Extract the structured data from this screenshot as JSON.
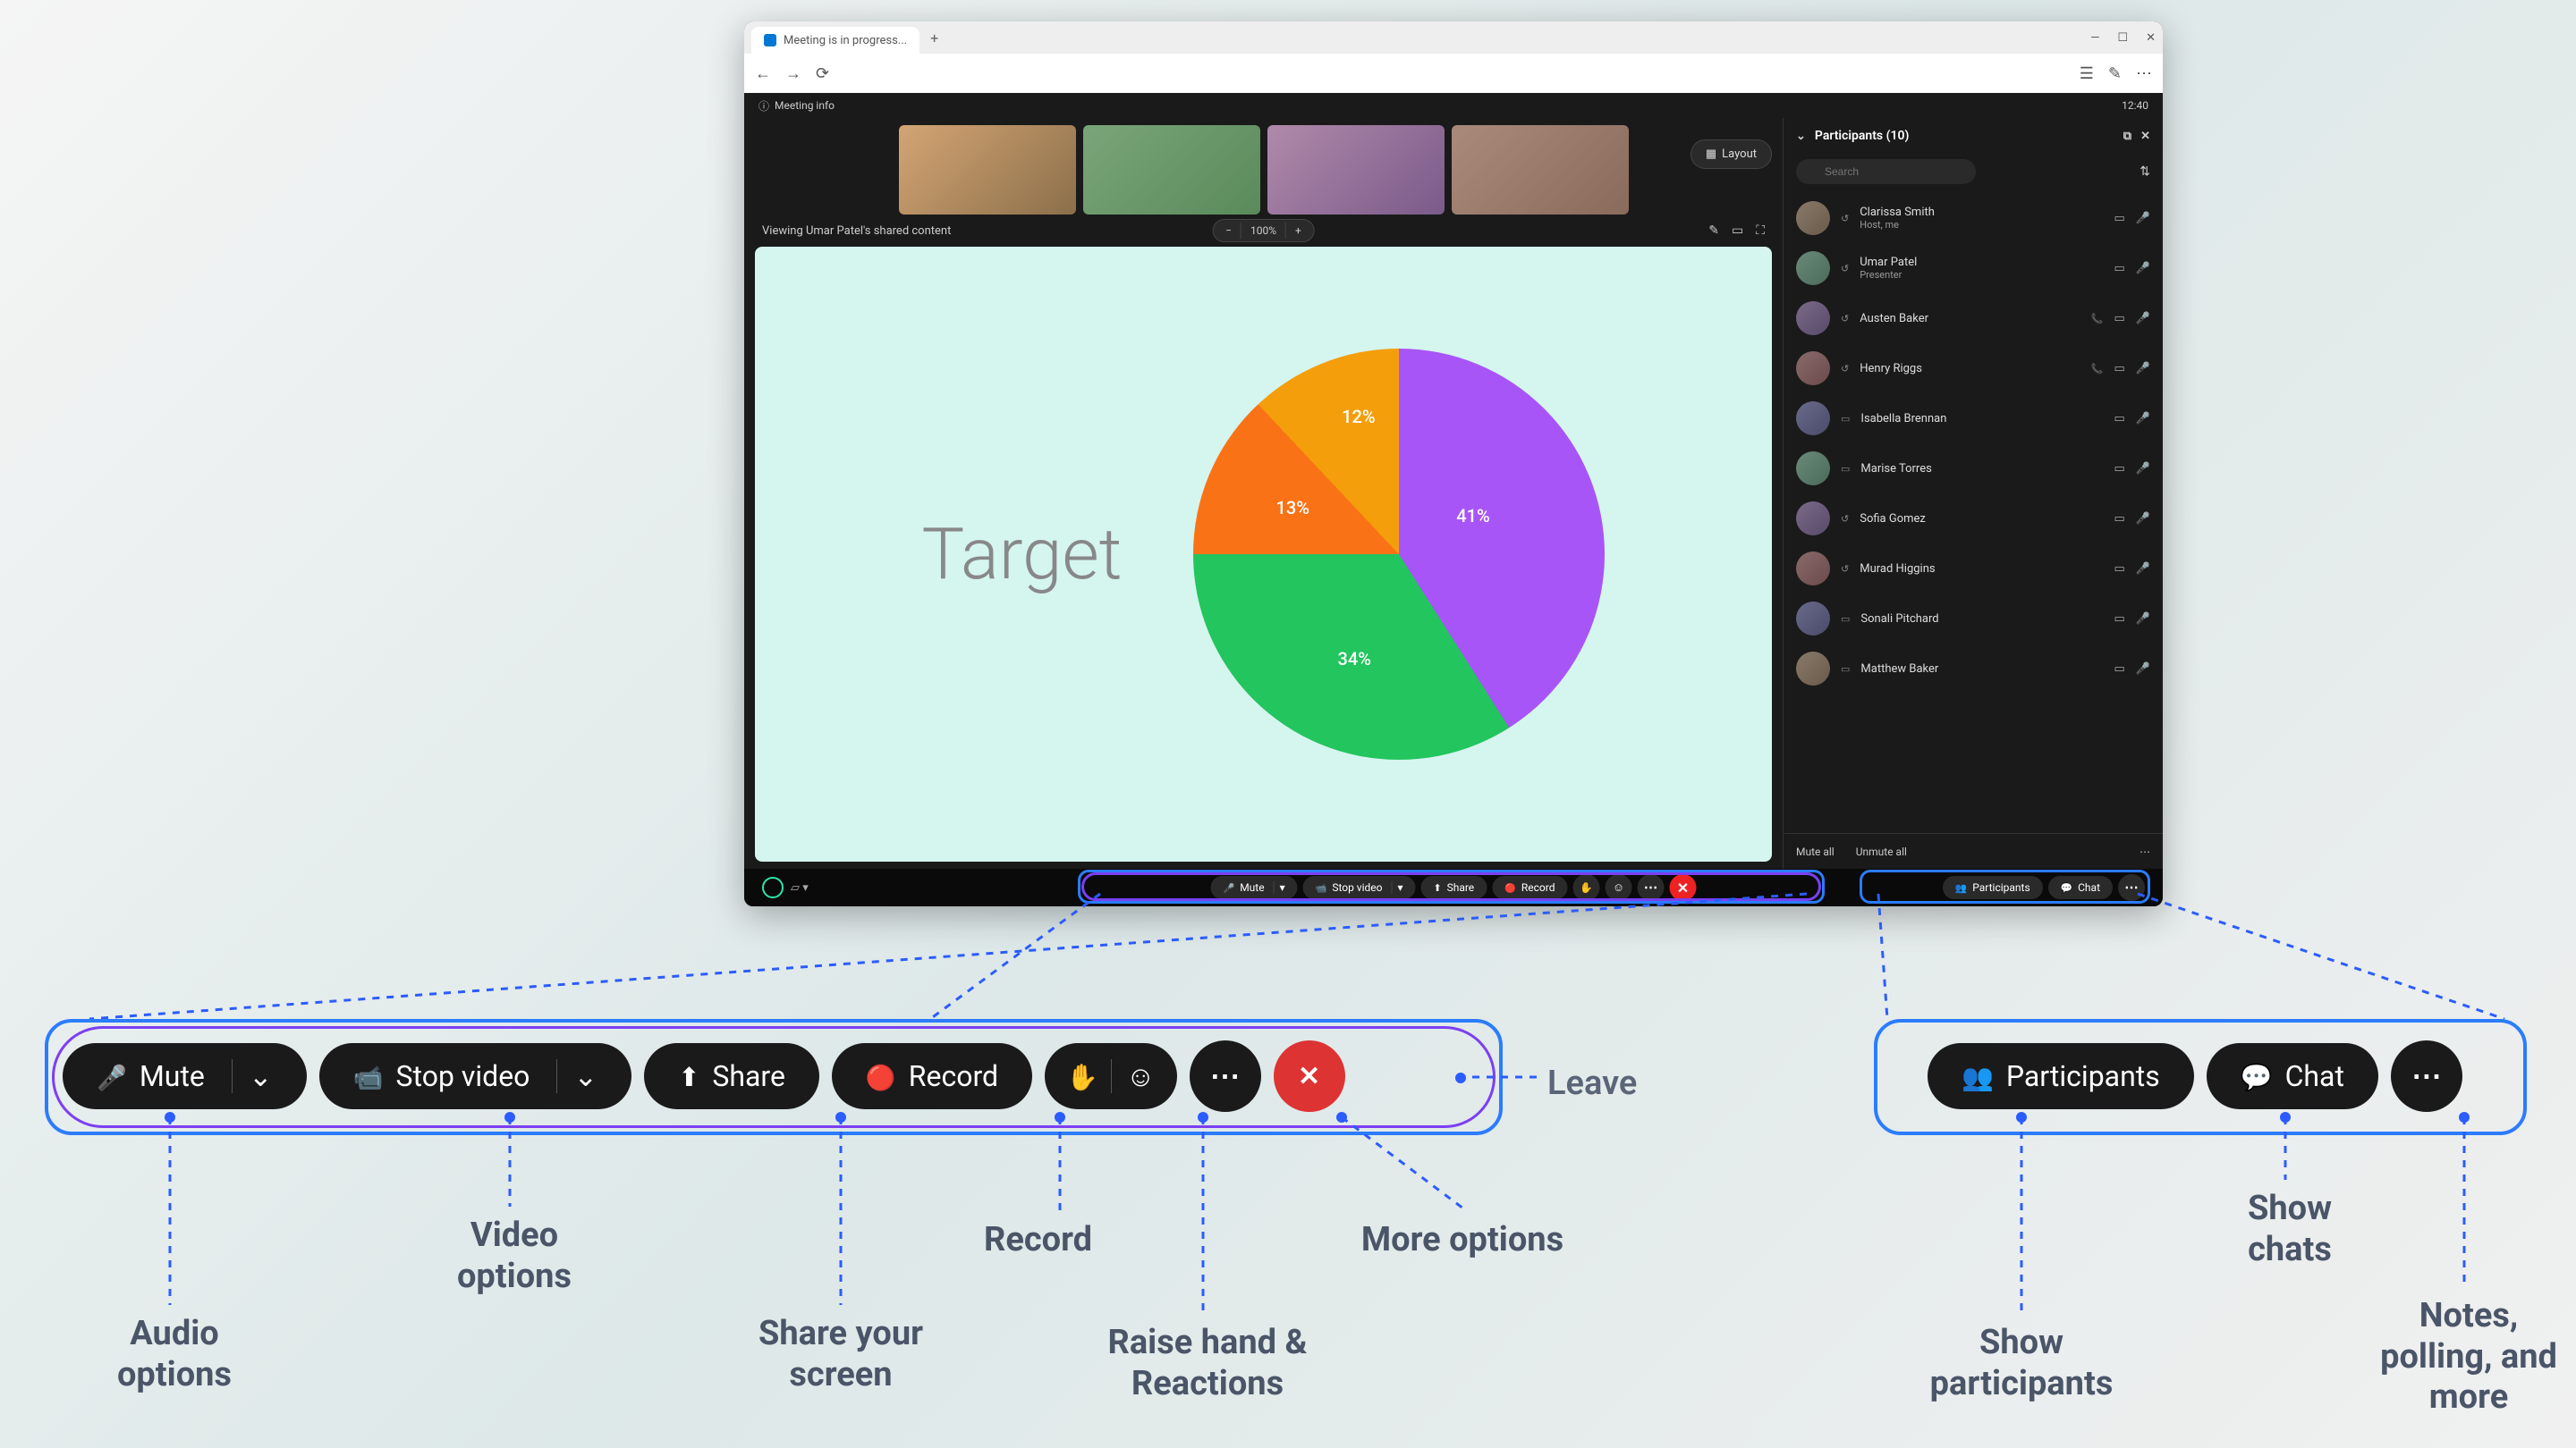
{
  "window": {
    "tab_title": "Meeting is in progress...",
    "meeting_info": "Meeting info",
    "clock": "12:40"
  },
  "layout_button": "Layout",
  "share_status": "Viewing Umar Patel's shared content",
  "zoom": {
    "minus": "−",
    "value": "100%",
    "plus": "+"
  },
  "shared": {
    "title": "Target"
  },
  "chart_data": {
    "type": "pie",
    "title": "Target",
    "slices": [
      {
        "label": "41%",
        "value": 41,
        "color": "#a855f7"
      },
      {
        "label": "34%",
        "value": 34,
        "color": "#22c55e"
      },
      {
        "label": "13%",
        "value": 13,
        "color": "#f97316"
      },
      {
        "label": "12%",
        "value": 12,
        "color": "#f59e0b"
      }
    ]
  },
  "participants": {
    "title": "Participants (10)",
    "search_placeholder": "Search",
    "list": [
      {
        "name": "Clarissa Smith",
        "sub": "Host, me",
        "mic": "on",
        "cam": true
      },
      {
        "name": "Umar Patel",
        "sub": "Presenter",
        "mic": "on",
        "cam": true
      },
      {
        "name": "Austen Baker",
        "sub": "",
        "mic": "off",
        "cam": true,
        "phone": true
      },
      {
        "name": "Henry Riggs",
        "sub": "",
        "mic": "off",
        "cam": true,
        "phone": true
      },
      {
        "name": "Isabella Brennan",
        "sub": "",
        "mic": "off",
        "cam": true
      },
      {
        "name": "Marise Torres",
        "sub": "",
        "mic": "off",
        "cam": true
      },
      {
        "name": "Sofia Gomez",
        "sub": "",
        "mic": "on",
        "cam": true
      },
      {
        "name": "Murad Higgins",
        "sub": "",
        "mic": "off",
        "cam": true
      },
      {
        "name": "Sonali Pitchard",
        "sub": "",
        "mic": "off",
        "cam": true
      },
      {
        "name": "Matthew Baker",
        "sub": "",
        "mic": "off",
        "cam": true
      }
    ],
    "mute_all": "Mute all",
    "unmute_all": "Unmute all"
  },
  "toolbar": {
    "mute": "Mute",
    "stop_video": "Stop video",
    "share": "Share",
    "record": "Record",
    "participants": "Participants",
    "chat": "Chat"
  },
  "annotations": {
    "audio": "Audio options",
    "video": "Video options",
    "share": "Share your screen",
    "record": "Record",
    "raise": "Raise hand & Reactions",
    "more": "More options",
    "leave": "Leave",
    "show_participants": "Show participants",
    "show_chats": "Show chats",
    "notes": "Notes, polling, and more"
  }
}
